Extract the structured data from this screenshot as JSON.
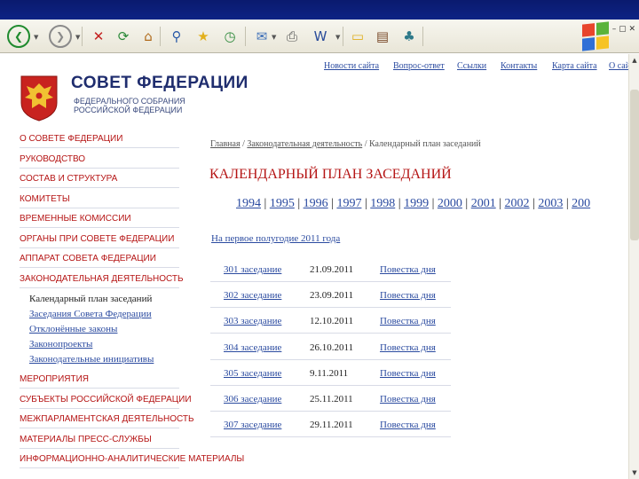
{
  "browser": {
    "toolbar_icons": [
      {
        "name": "back-icon",
        "glyph": "❮",
        "color": "#1f8a2e"
      },
      {
        "name": "forward-icon",
        "glyph": "❯",
        "color": "#8a8a8a"
      },
      {
        "name": "stop-icon",
        "glyph": "✕",
        "color": "#c42020"
      },
      {
        "name": "refresh-icon",
        "glyph": "⟳",
        "color": "#2c8a3a"
      },
      {
        "name": "home-icon",
        "glyph": "⌂",
        "color": "#b06a1a"
      },
      {
        "name": "search-icon",
        "glyph": "⚲",
        "color": "#2a5aa8"
      },
      {
        "name": "favorites-icon",
        "glyph": "★",
        "color": "#e2b01c"
      },
      {
        "name": "history-icon",
        "glyph": "◷",
        "color": "#2f8a3c"
      },
      {
        "name": "mail-icon",
        "glyph": "✉",
        "color": "#3e6fb8"
      },
      {
        "name": "print-icon",
        "glyph": "⎙",
        "color": "#555555"
      },
      {
        "name": "edit-icon",
        "glyph": "W",
        "color": "#2a4c9a"
      },
      {
        "name": "discuss-icon",
        "glyph": "▭",
        "color": "#e0b020"
      },
      {
        "name": "research-icon",
        "glyph": "▤",
        "color": "#7a4a2a"
      },
      {
        "name": "messenger-icon",
        "glyph": "♣",
        "color": "#2f7a8a"
      }
    ]
  },
  "header": {
    "title": "СОВЕТ ФЕДЕРАЦИИ",
    "subtitle": "ФЕДЕРАЛЬНОГО СОБРАНИЯ РОССИЙСКОЙ ФЕДЕРАЦИИ",
    "top_links": [
      "Новости сайта",
      "Вопрос-ответ",
      "Ссылки",
      "Контакты",
      "Карта сайта",
      "О сай"
    ]
  },
  "sidebar": {
    "items": [
      "О СОВЕТЕ ФЕДЕРАЦИИ",
      "РУКОВОДСТВО",
      "СОСТАВ И СТРУКТУРА",
      "КОМИТЕТЫ",
      "ВРЕМЕННЫЕ КОМИССИИ",
      "ОРГАНЫ ПРИ СОВЕТЕ ФЕДЕРАЦИИ",
      "АППАРАТ СОВЕТА ФЕДЕРАЦИИ",
      "ЗАКОНОДАТЕЛЬНАЯ ДЕЯТЕЛЬНОСТЬ"
    ],
    "subitems": [
      "Календарный план заседаний",
      "Заседания Совета Федерации",
      "Отклонённые законы",
      "Законопроекты",
      "Законодательные инициативы"
    ],
    "items_after": [
      "МЕРОПРИЯТИЯ",
      "СУБЪЕКТЫ РОССИЙСКОЙ ФЕДЕРАЦИИ",
      "МЕЖПАРЛАМЕНТСКАЯ ДЕЯТЕЛЬНОСТЬ",
      "МАТЕРИАЛЫ ПРЕСС-СЛУЖБЫ",
      "ИНФОРМАЦИОННО-АНАЛИТИЧЕСКИЕ МАТЕРИАЛЫ"
    ]
  },
  "breadcrumb": {
    "items": [
      "Главная",
      "Законодательная деятельность",
      "Календарный план заседаний"
    ],
    "separator": " / "
  },
  "main": {
    "title": "КАЛЕНДАРНЫЙ ПЛАН ЗАСЕДАНИЙ",
    "years": [
      "1994",
      "1995",
      "1996",
      "1997",
      "1998",
      "1999",
      "2000",
      "2001",
      "2002",
      "2003",
      "200"
    ],
    "period_link": "На первое полугодие 2011 года",
    "sessions": [
      {
        "session": "301 заседание",
        "date": "21.09.2011",
        "agenda": "Повестка дня"
      },
      {
        "session": "302 заседание",
        "date": "23.09.2011",
        "agenda": "Повестка дня"
      },
      {
        "session": "303 заседание",
        "date": "12.10.2011",
        "agenda": "Повестка дня"
      },
      {
        "session": "304 заседание",
        "date": "26.10.2011",
        "agenda": "Повестка дня"
      },
      {
        "session": "305 заседание",
        "date": "9.11.2011",
        "agenda": "Повестка дня"
      },
      {
        "session": "306 заседание",
        "date": "25.11.2011",
        "agenda": "Повестка дня"
      },
      {
        "session": "307 заседание",
        "date": "29.11.2011",
        "agenda": "Повестка дня"
      }
    ]
  },
  "colors": {
    "menu_red": "#b51414",
    "link_blue": "#2b4ba0",
    "title_navy": "#1f2d6e"
  }
}
